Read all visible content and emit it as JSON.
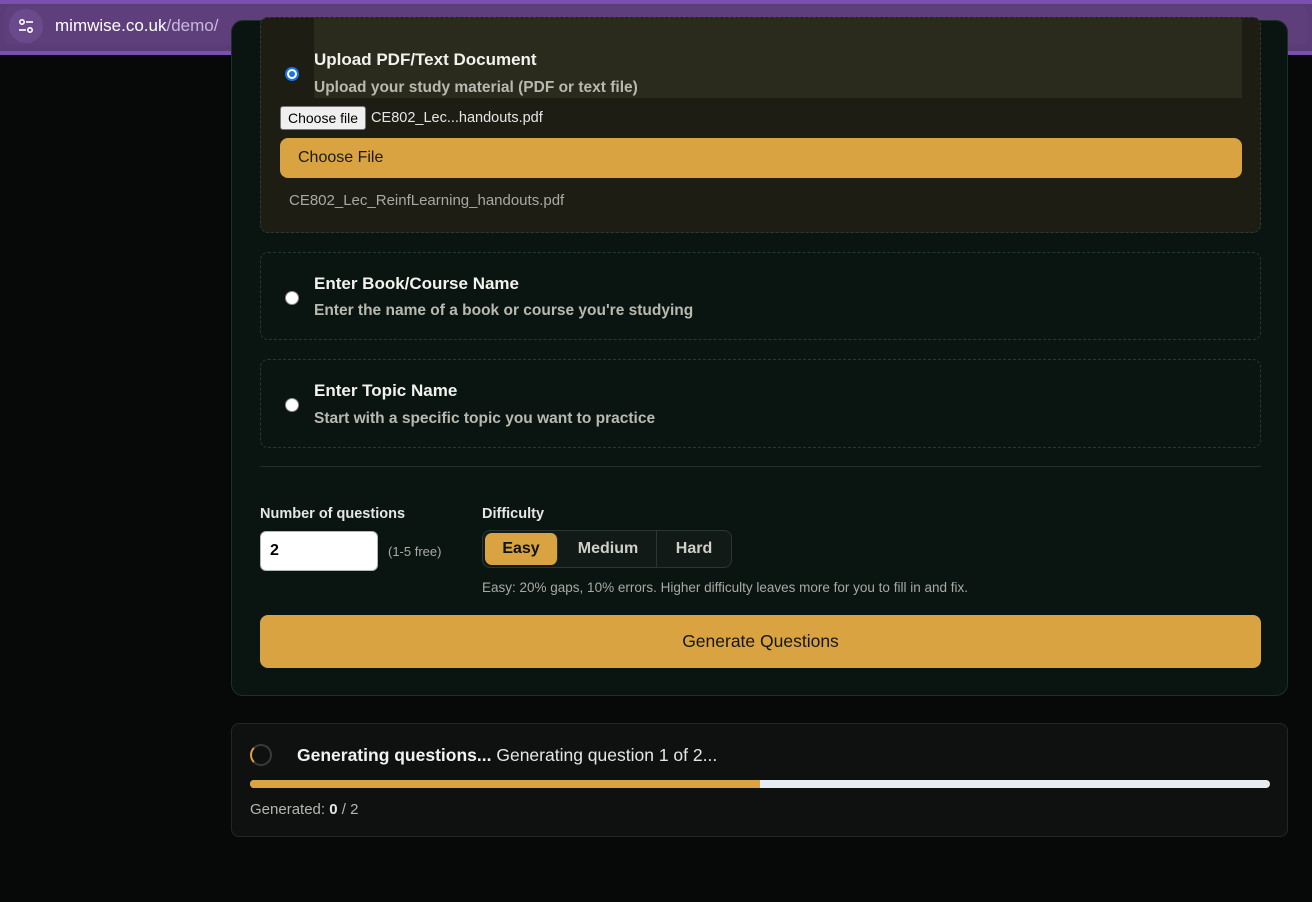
{
  "browser": {
    "url_domain": "mimwise.co.uk",
    "url_path": "/demo/",
    "site_info_icon": "tune-icon"
  },
  "source_options": [
    {
      "title": "Upload PDF/Text Document",
      "description": "Upload your study material (PDF or text file)",
      "selected": true
    },
    {
      "title": "Enter Book/Course Name",
      "description": "Enter the name of a book or course you're studying",
      "selected": false
    },
    {
      "title": "Enter Topic Name",
      "description": "Start with a specific topic you want to practice",
      "selected": false
    }
  ],
  "upload": {
    "native_button_label": "Choose file",
    "native_file_name": "CE802_Lec...handouts.pdf",
    "choose_button_label": "Choose File",
    "selected_file": "CE802_Lec_ReinfLearning_handouts.pdf"
  },
  "settings": {
    "num_questions_label": "Number of questions",
    "num_questions_value": "2",
    "num_questions_hint": "(1-5 free)",
    "difficulty_label": "Difficulty",
    "difficulty_options": [
      "Easy",
      "Medium",
      "Hard"
    ],
    "difficulty_selected": "Easy",
    "difficulty_description": "Easy: 20% gaps, 10% errors. Higher difficulty leaves more for you to fill in and fix."
  },
  "generate_button_label": "Generate Questions",
  "progress": {
    "status_bold": "Generating questions...",
    "status_detail": "Generating question 1 of 2...",
    "fraction": 0.5,
    "generated_label": "Generated:",
    "generated_count": "0",
    "generated_total": "/ 2"
  },
  "colors": {
    "accent": "#d9a342",
    "card_bg": "#0a1512",
    "page_bg": "#070908",
    "browser_bar": "#5e3f7c"
  }
}
